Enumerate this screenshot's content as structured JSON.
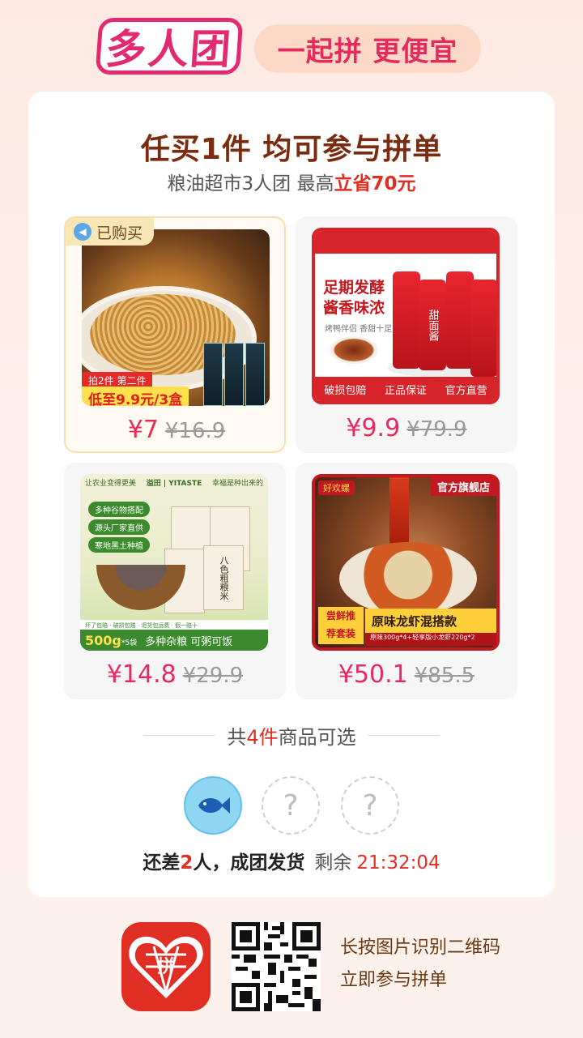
{
  "header": {
    "brand": "多人团",
    "slogan": "一起拼 更便宜"
  },
  "card": {
    "title": "任买1件 均可参与拼单",
    "subtitle_prefix": "粮油超市3人团 最高",
    "subtitle_highlight": "立省70元"
  },
  "products": [
    {
      "price": "¥7",
      "original_price": "¥16.9",
      "tag": "已购买",
      "image_text": [
        "拍2件 第二件",
        "低至9.9元/3盒"
      ]
    },
    {
      "price": "¥9.9",
      "original_price": "¥79.9",
      "image_text": [
        "足期发酵",
        "酱香味浓",
        "烤鸭伴侣 香甜十足",
        "甜面酱",
        "破损包赔",
        "正品保证",
        "官方直营"
      ]
    },
    {
      "price": "¥14.8",
      "original_price": "¥29.9",
      "image_text": [
        "让农业变得更美",
        "溢田 | YITASTE",
        "幸福是种出来的",
        "多种谷物搭配",
        "源头厂家直供",
        "寒地黑土种植",
        "八色粗粮米",
        "坏了包赔",
        "破损包赔",
        "退货包运费",
        "假一赔十",
        "500g",
        "*5袋",
        "多种杂粮 可粥可饭"
      ]
    },
    {
      "price": "¥50.1",
      "original_price": "¥85.5",
      "image_text": [
        "好欢螺",
        "官方旗舰店",
        "尝鲜推",
        "荐套装",
        "原味龙虾混搭款",
        "原味300g*4+轻享版小龙虾220g*2"
      ]
    }
  ],
  "divider": {
    "prefix": "共",
    "count": "4件",
    "suffix": "商品可选"
  },
  "group": {
    "members_total": 3,
    "members_joined": 1,
    "empty_symbol": "?",
    "status_prefix": "还差",
    "status_count": "2",
    "status_suffix": "人，成团发货",
    "remain_label": "剩余",
    "countdown": "21:32:04"
  },
  "footer": {
    "app_icon_text": "拼",
    "line1": "长按图片识别二维码",
    "line2": "立即参与拼单"
  },
  "colors": {
    "brand_pink": "#e3296f",
    "price_pink": "#e52a5e",
    "highlight_red": "#e02e24",
    "title_brown": "#7a2c10"
  }
}
